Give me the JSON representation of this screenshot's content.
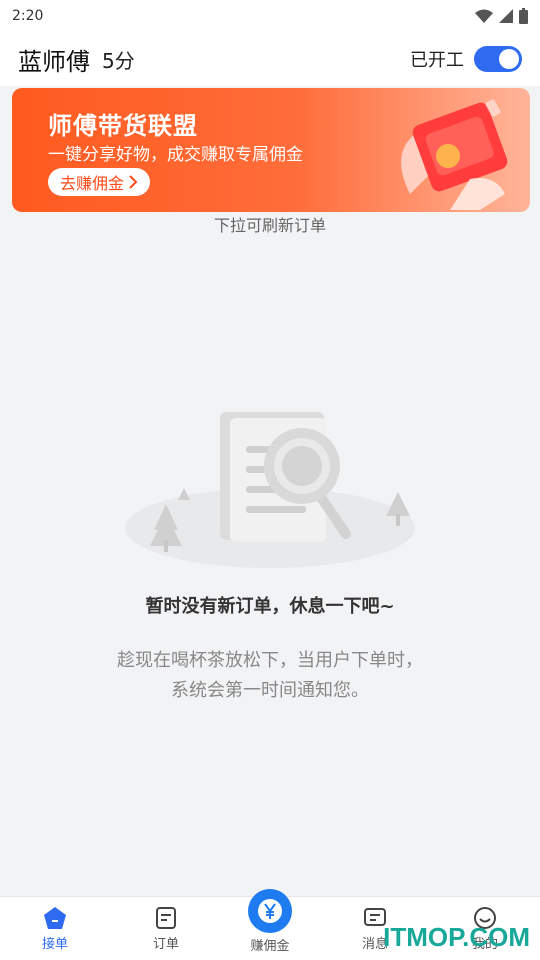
{
  "status_bar": {
    "time": "2:20"
  },
  "header": {
    "name": "蓝师傅",
    "score": "5分",
    "work_label": "已开工",
    "work_toggle_on": true
  },
  "banner": {
    "title": "师傅带货联盟",
    "subtitle": "一键分享好物，成交赚取专属佣金",
    "button_label": "去赚佣金"
  },
  "pull_hint": "下拉可刷新订单",
  "empty_state": {
    "title": "暂时没有新订单，休息一下吧~",
    "line1": "趁现在喝杯茶放松下，当用户下单时，",
    "line2": "系统会第一时间通知您。"
  },
  "nav": {
    "items": [
      {
        "label": "接单",
        "icon": "home-icon",
        "active": true
      },
      {
        "label": "订单",
        "icon": "order-icon",
        "active": false
      },
      {
        "label": "赚佣金",
        "icon": "yen-icon",
        "active": false
      },
      {
        "label": "消息",
        "icon": "message-icon",
        "active": false
      },
      {
        "label": "我的",
        "icon": "profile-icon",
        "active": false
      }
    ]
  },
  "watermark": "ITMOP.COM",
  "colors": {
    "accent": "#2f6bf0",
    "banner": "#ff5a1f",
    "watermark": "#17a89a"
  }
}
